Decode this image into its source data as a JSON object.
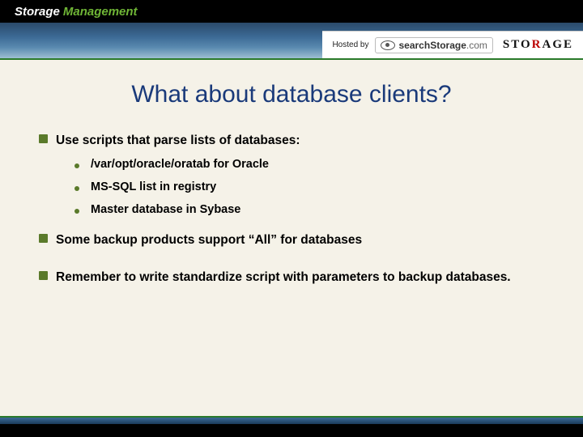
{
  "header": {
    "brand_part1": "Storage",
    "brand_part2": "Management",
    "hosted_by": "Hosted by",
    "search_prefix": "search",
    "search_main": "Storage",
    "search_suffix": ".com",
    "storage_word": "STORAGE"
  },
  "slide": {
    "title": "What about database clients?"
  },
  "bullets": [
    {
      "text": "Use scripts that parse lists of databases:",
      "children": [
        "/var/opt/oracle/oratab for Oracle",
        "MS-SQL list in registry",
        "Master database in Sybase"
      ]
    },
    {
      "text": "Some backup products support “All” for databases",
      "children": []
    },
    {
      "text": "Remember to write standardize script with parameters to backup databases.",
      "children": []
    }
  ]
}
